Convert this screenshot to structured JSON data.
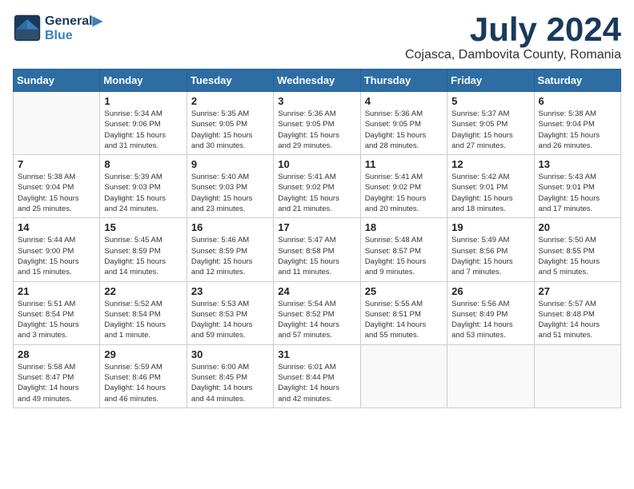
{
  "header": {
    "logo_line1": "General",
    "logo_line2": "Blue",
    "month": "July 2024",
    "location": "Cojasca, Dambovita County, Romania"
  },
  "days_of_week": [
    "Sunday",
    "Monday",
    "Tuesday",
    "Wednesday",
    "Thursday",
    "Friday",
    "Saturday"
  ],
  "weeks": [
    [
      {
        "num": "",
        "info": ""
      },
      {
        "num": "1",
        "info": "Sunrise: 5:34 AM\nSunset: 9:06 PM\nDaylight: 15 hours\nand 31 minutes."
      },
      {
        "num": "2",
        "info": "Sunrise: 5:35 AM\nSunset: 9:05 PM\nDaylight: 15 hours\nand 30 minutes."
      },
      {
        "num": "3",
        "info": "Sunrise: 5:36 AM\nSunset: 9:05 PM\nDaylight: 15 hours\nand 29 minutes."
      },
      {
        "num": "4",
        "info": "Sunrise: 5:36 AM\nSunset: 9:05 PM\nDaylight: 15 hours\nand 28 minutes."
      },
      {
        "num": "5",
        "info": "Sunrise: 5:37 AM\nSunset: 9:05 PM\nDaylight: 15 hours\nand 27 minutes."
      },
      {
        "num": "6",
        "info": "Sunrise: 5:38 AM\nSunset: 9:04 PM\nDaylight: 15 hours\nand 26 minutes."
      }
    ],
    [
      {
        "num": "7",
        "info": "Sunrise: 5:38 AM\nSunset: 9:04 PM\nDaylight: 15 hours\nand 25 minutes."
      },
      {
        "num": "8",
        "info": "Sunrise: 5:39 AM\nSunset: 9:03 PM\nDaylight: 15 hours\nand 24 minutes."
      },
      {
        "num": "9",
        "info": "Sunrise: 5:40 AM\nSunset: 9:03 PM\nDaylight: 15 hours\nand 23 minutes."
      },
      {
        "num": "10",
        "info": "Sunrise: 5:41 AM\nSunset: 9:02 PM\nDaylight: 15 hours\nand 21 minutes."
      },
      {
        "num": "11",
        "info": "Sunrise: 5:41 AM\nSunset: 9:02 PM\nDaylight: 15 hours\nand 20 minutes."
      },
      {
        "num": "12",
        "info": "Sunrise: 5:42 AM\nSunset: 9:01 PM\nDaylight: 15 hours\nand 18 minutes."
      },
      {
        "num": "13",
        "info": "Sunrise: 5:43 AM\nSunset: 9:01 PM\nDaylight: 15 hours\nand 17 minutes."
      }
    ],
    [
      {
        "num": "14",
        "info": "Sunrise: 5:44 AM\nSunset: 9:00 PM\nDaylight: 15 hours\nand 15 minutes."
      },
      {
        "num": "15",
        "info": "Sunrise: 5:45 AM\nSunset: 8:59 PM\nDaylight: 15 hours\nand 14 minutes."
      },
      {
        "num": "16",
        "info": "Sunrise: 5:46 AM\nSunset: 8:59 PM\nDaylight: 15 hours\nand 12 minutes."
      },
      {
        "num": "17",
        "info": "Sunrise: 5:47 AM\nSunset: 8:58 PM\nDaylight: 15 hours\nand 11 minutes."
      },
      {
        "num": "18",
        "info": "Sunrise: 5:48 AM\nSunset: 8:57 PM\nDaylight: 15 hours\nand 9 minutes."
      },
      {
        "num": "19",
        "info": "Sunrise: 5:49 AM\nSunset: 8:56 PM\nDaylight: 15 hours\nand 7 minutes."
      },
      {
        "num": "20",
        "info": "Sunrise: 5:50 AM\nSunset: 8:55 PM\nDaylight: 15 hours\nand 5 minutes."
      }
    ],
    [
      {
        "num": "21",
        "info": "Sunrise: 5:51 AM\nSunset: 8:54 PM\nDaylight: 15 hours\nand 3 minutes."
      },
      {
        "num": "22",
        "info": "Sunrise: 5:52 AM\nSunset: 8:54 PM\nDaylight: 15 hours\nand 1 minute."
      },
      {
        "num": "23",
        "info": "Sunrise: 5:53 AM\nSunset: 8:53 PM\nDaylight: 14 hours\nand 59 minutes."
      },
      {
        "num": "24",
        "info": "Sunrise: 5:54 AM\nSunset: 8:52 PM\nDaylight: 14 hours\nand 57 minutes."
      },
      {
        "num": "25",
        "info": "Sunrise: 5:55 AM\nSunset: 8:51 PM\nDaylight: 14 hours\nand 55 minutes."
      },
      {
        "num": "26",
        "info": "Sunrise: 5:56 AM\nSunset: 8:49 PM\nDaylight: 14 hours\nand 53 minutes."
      },
      {
        "num": "27",
        "info": "Sunrise: 5:57 AM\nSunset: 8:48 PM\nDaylight: 14 hours\nand 51 minutes."
      }
    ],
    [
      {
        "num": "28",
        "info": "Sunrise: 5:58 AM\nSunset: 8:47 PM\nDaylight: 14 hours\nand 49 minutes."
      },
      {
        "num": "29",
        "info": "Sunrise: 5:59 AM\nSunset: 8:46 PM\nDaylight: 14 hours\nand 46 minutes."
      },
      {
        "num": "30",
        "info": "Sunrise: 6:00 AM\nSunset: 8:45 PM\nDaylight: 14 hours\nand 44 minutes."
      },
      {
        "num": "31",
        "info": "Sunrise: 6:01 AM\nSunset: 8:44 PM\nDaylight: 14 hours\nand 42 minutes."
      },
      {
        "num": "",
        "info": ""
      },
      {
        "num": "",
        "info": ""
      },
      {
        "num": "",
        "info": ""
      }
    ]
  ]
}
